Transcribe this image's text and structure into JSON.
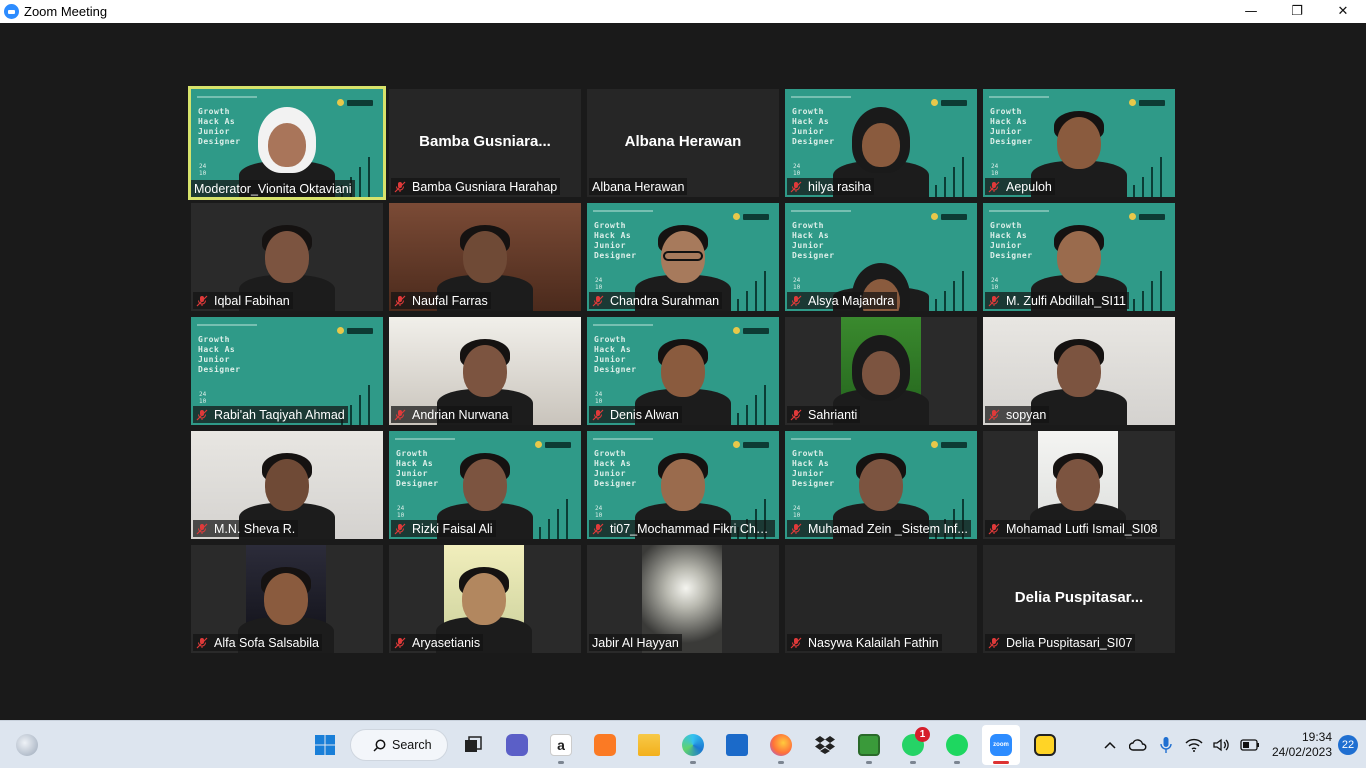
{
  "window": {
    "title": "Zoom Meeting",
    "minimize": "—",
    "maximize": "❐",
    "close": "✕"
  },
  "slide_background": {
    "line1": "Growth",
    "line2": "Hack As",
    "line3": "Junior",
    "line4": "Designer",
    "num1": "24",
    "num2": "10",
    "logo": "ULIKINDO Academy"
  },
  "participants": [
    {
      "name": "Moderator_Vionita Oktaviani",
      "muted": false,
      "video": "slide",
      "active": true
    },
    {
      "name": "Bamba Gusniara Harahap",
      "center_name": "Bamba  Gusniara...",
      "muted": true,
      "video": "off"
    },
    {
      "name": "Albana Herawan",
      "center_name": "Albana Herawan",
      "muted": false,
      "video": "off"
    },
    {
      "name": "hilya rasiha",
      "muted": true,
      "video": "slide"
    },
    {
      "name": "Aepuloh",
      "muted": true,
      "video": "slide"
    },
    {
      "name": "Iqbal Fabihan",
      "muted": true,
      "video": "camera"
    },
    {
      "name": "Naufal Farras",
      "muted": true,
      "video": "camera"
    },
    {
      "name": "Chandra Surahman",
      "muted": true,
      "video": "slide"
    },
    {
      "name": "Alsya Majandra",
      "muted": true,
      "video": "slide"
    },
    {
      "name": "M. Zulfi Abdillah_SI11",
      "muted": true,
      "video": "slide"
    },
    {
      "name": "Rabi'ah Taqiyah Ahmad",
      "muted": true,
      "video": "slide"
    },
    {
      "name": "Andrian Nurwana",
      "muted": true,
      "video": "camera"
    },
    {
      "name": "Denis Alwan",
      "muted": true,
      "video": "slide"
    },
    {
      "name": "Sahrianti",
      "muted": true,
      "video": "camera"
    },
    {
      "name": "sopyan",
      "muted": true,
      "video": "camera"
    },
    {
      "name": "M.N. Sheva R.",
      "muted": true,
      "video": "camera"
    },
    {
      "name": "Rizki Faisal Ali",
      "muted": true,
      "video": "slide"
    },
    {
      "name": "ti07_Mochammad Fikri Cha...",
      "muted": true,
      "video": "slide"
    },
    {
      "name": "Muhamad Zein _Sistem Inf...",
      "muted": true,
      "video": "slide"
    },
    {
      "name": "Mohamad Lutfi Ismail_SI08",
      "muted": true,
      "video": "camera"
    },
    {
      "name": "Alfa Sofa Salsabila",
      "muted": true,
      "video": "camera"
    },
    {
      "name": "Aryasetianis",
      "muted": true,
      "video": "camera"
    },
    {
      "name": "Jabir Al Hayyan",
      "muted": false,
      "video": "camera"
    },
    {
      "name": "Nasywa Kalailah Fathin",
      "muted": true,
      "video": "off"
    },
    {
      "name": "Delia Puspitasari_SI07",
      "center_name": "Delia  Puspitasar...",
      "muted": true,
      "video": "off"
    }
  ],
  "taskbar": {
    "search_label": "Search",
    "whatsapp_badge": "1",
    "time": "19:34",
    "date": "24/02/2023",
    "notifications": "22",
    "apps": [
      "start-icon",
      "search",
      "task-view-icon",
      "teams-icon",
      "amazon-icon",
      "xampp-icon",
      "file-explorer-icon",
      "edge-icon",
      "store-icon",
      "firefox-icon",
      "dropbox-icon",
      "notepad-icon",
      "whatsapp-icon",
      "spotify-icon",
      "zoom-icon",
      "norton-icon"
    ]
  },
  "colors": {
    "slide_bg": "#2f9a88",
    "active_speaker": "#d7e36b",
    "muted_red": "#e03a3a",
    "taskbar": "#dde5ef"
  }
}
